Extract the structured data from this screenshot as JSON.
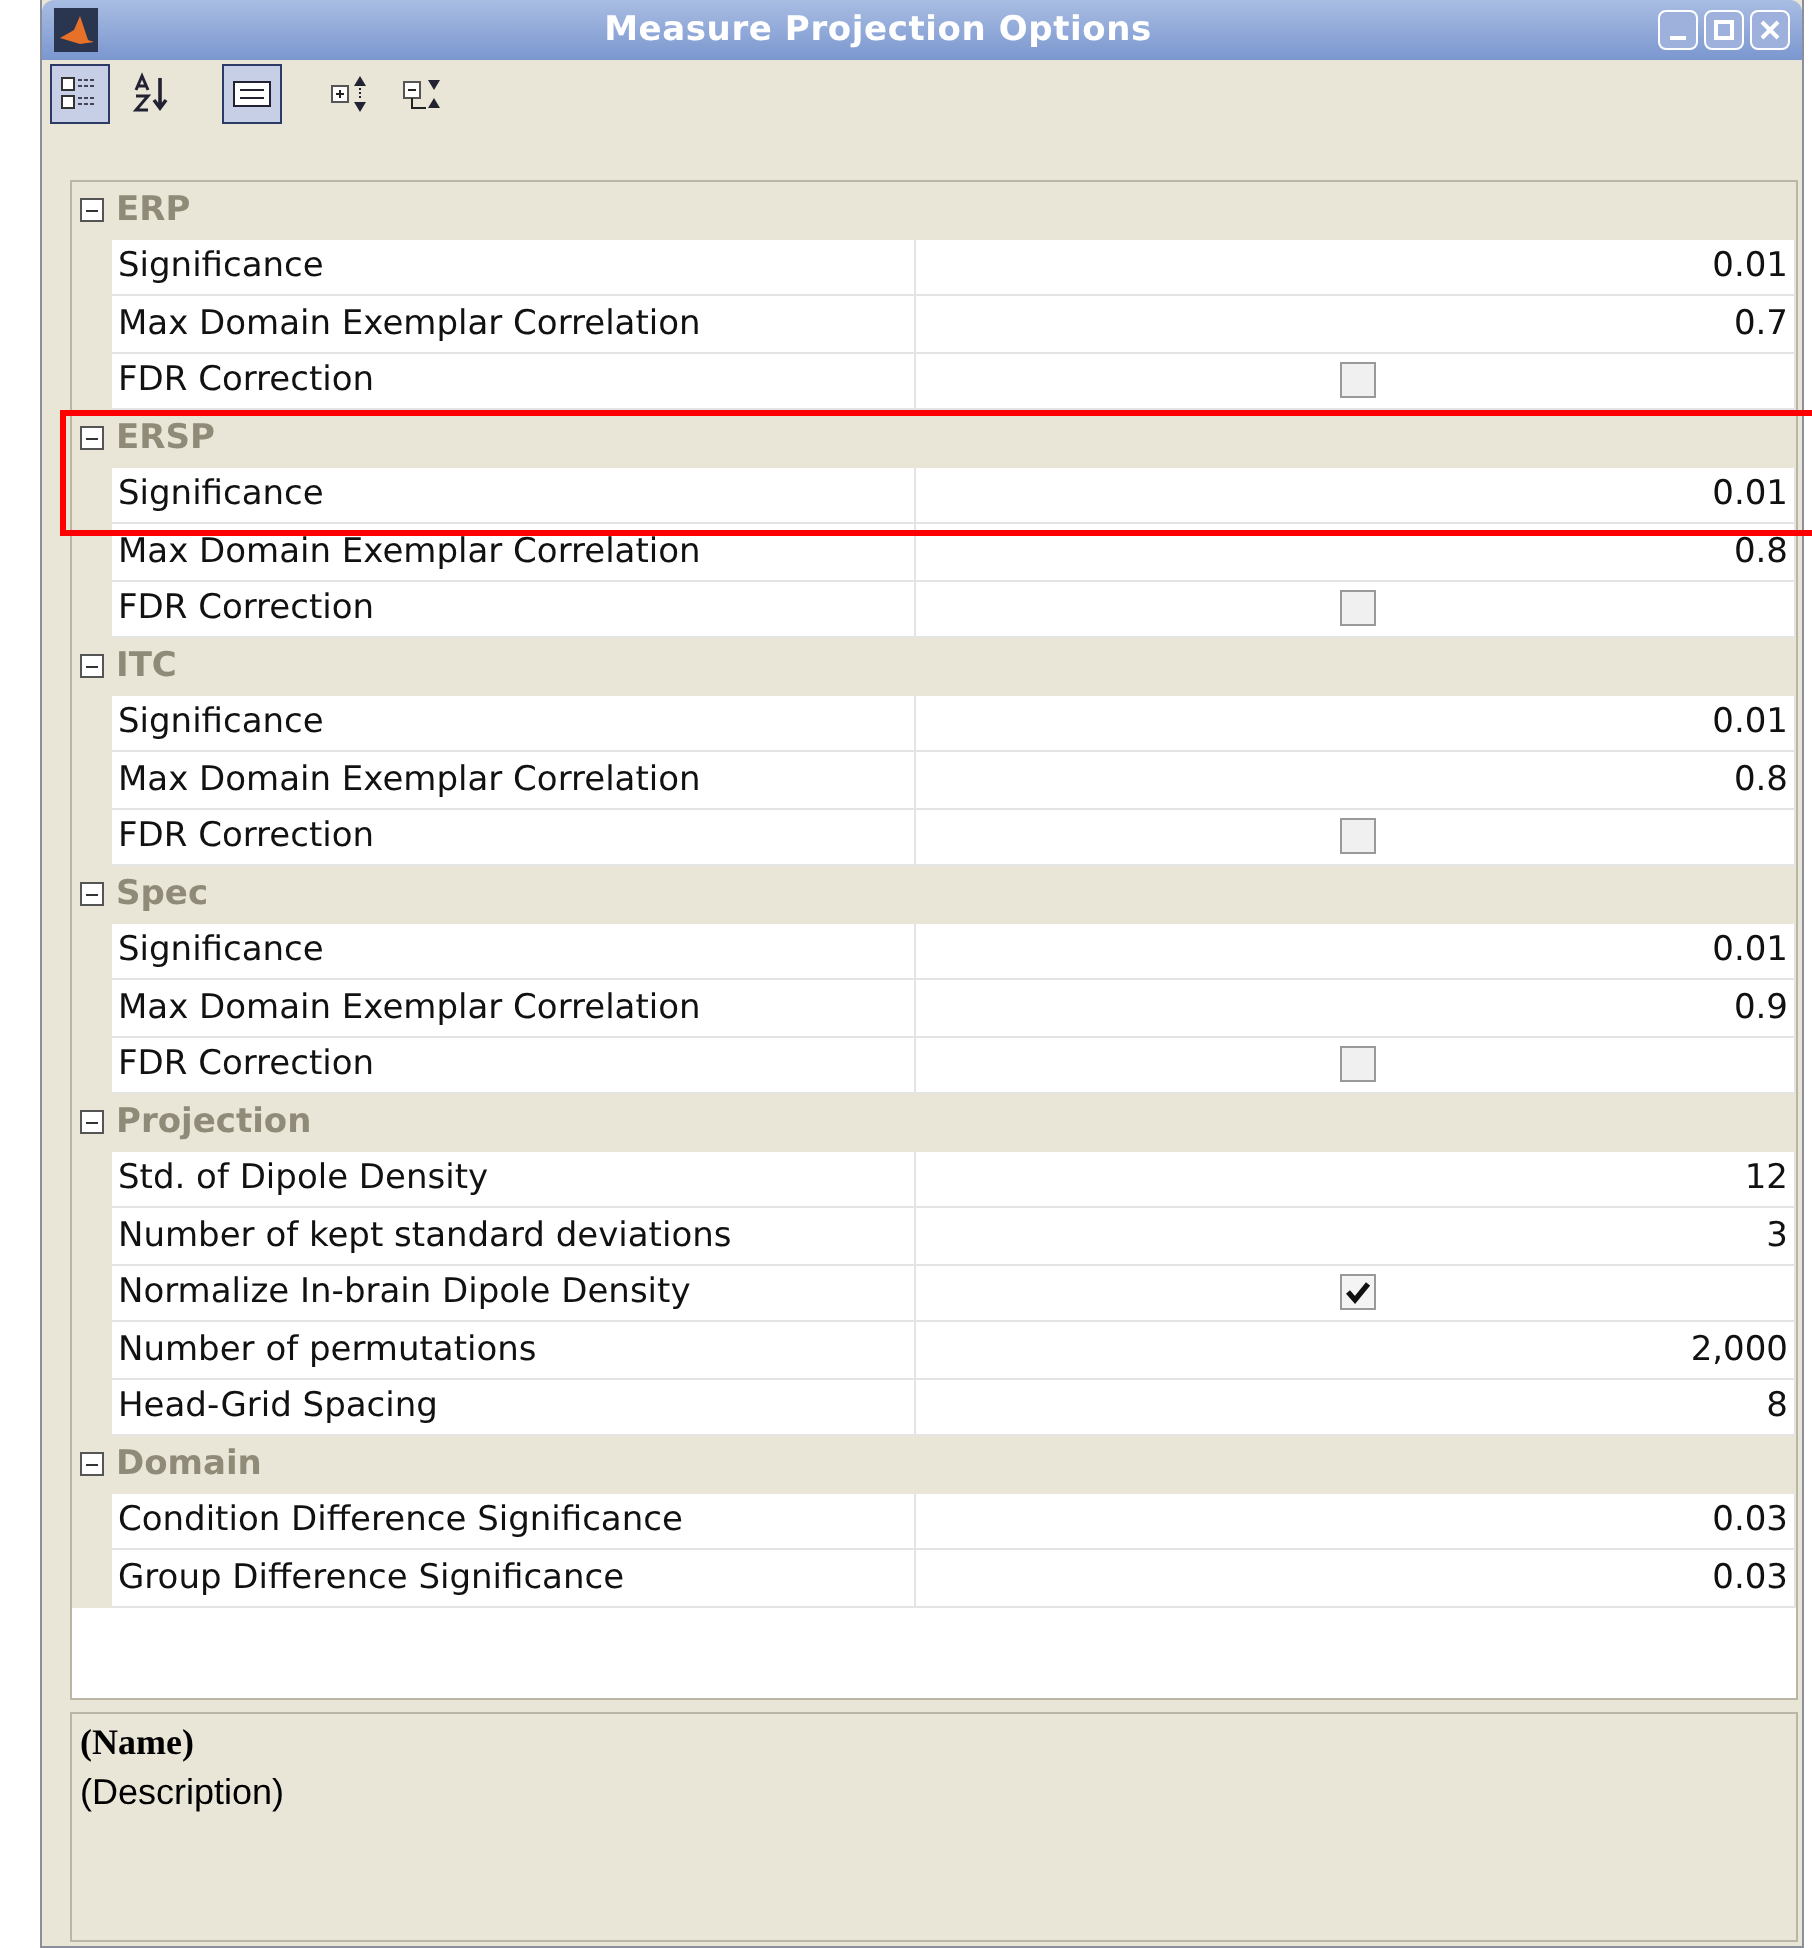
{
  "window": {
    "title": "Measure Projection Options"
  },
  "toolbar": [
    {
      "kind": "categorized",
      "selected": true
    },
    {
      "kind": "sort",
      "selected": false
    },
    {
      "kind": "description",
      "selected": true
    },
    {
      "kind": "expand",
      "selected": false
    },
    {
      "kind": "collapse",
      "selected": false
    }
  ],
  "groups": [
    {
      "name": "ERP",
      "expanded": true,
      "highlighted": false,
      "rows": [
        {
          "kind": "value",
          "label": "Significance",
          "value": "0.01"
        },
        {
          "kind": "value",
          "label": "Max Domain Exemplar Correlation",
          "value": "0.7"
        },
        {
          "kind": "checkbox",
          "label": "FDR Correction",
          "checked": false
        }
      ]
    },
    {
      "name": "ERSP",
      "expanded": true,
      "highlighted": true,
      "rows": [
        {
          "kind": "value",
          "label": "Significance",
          "value": "0.01"
        },
        {
          "kind": "value",
          "label": "Max Domain Exemplar Correlation",
          "value": "0.8"
        },
        {
          "kind": "checkbox",
          "label": "FDR Correction",
          "checked": false
        }
      ]
    },
    {
      "name": "ITC",
      "expanded": true,
      "highlighted": false,
      "rows": [
        {
          "kind": "value",
          "label": "Significance",
          "value": "0.01"
        },
        {
          "kind": "value",
          "label": "Max Domain Exemplar Correlation",
          "value": "0.8"
        },
        {
          "kind": "checkbox",
          "label": "FDR Correction",
          "checked": false
        }
      ]
    },
    {
      "name": "Spec",
      "expanded": true,
      "highlighted": false,
      "rows": [
        {
          "kind": "value",
          "label": "Significance",
          "value": "0.01"
        },
        {
          "kind": "value",
          "label": "Max Domain Exemplar Correlation",
          "value": "0.9"
        },
        {
          "kind": "checkbox",
          "label": "FDR Correction",
          "checked": false
        }
      ]
    },
    {
      "name": "Projection",
      "expanded": true,
      "highlighted": false,
      "rows": [
        {
          "kind": "value",
          "label": "Std. of Dipole Density",
          "value": "12"
        },
        {
          "kind": "value",
          "label": "Number of kept standard deviations",
          "value": "3"
        },
        {
          "kind": "checkbox",
          "label": "Normalize In-brain Dipole Density",
          "checked": true
        },
        {
          "kind": "value",
          "label": "Number of permutations",
          "value": "2,000"
        },
        {
          "kind": "value",
          "label": "Head-Grid Spacing",
          "value": "8"
        }
      ]
    },
    {
      "name": "Domain",
      "expanded": true,
      "highlighted": false,
      "rows": [
        {
          "kind": "value",
          "label": "Condition Difference Significance",
          "value": "0.03"
        },
        {
          "kind": "value",
          "label": "Group Difference Significance",
          "value": "0.03"
        }
      ]
    }
  ],
  "description": {
    "name": "(Name)",
    "text": "(Description)"
  }
}
